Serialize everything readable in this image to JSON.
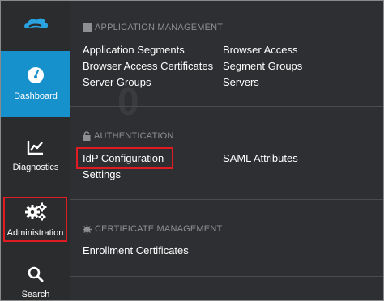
{
  "sidebar": {
    "items": [
      {
        "label": "Dashboard"
      },
      {
        "label": "Diagnostics"
      },
      {
        "label": "Administration"
      },
      {
        "label": "Search"
      }
    ]
  },
  "menu": {
    "sections": [
      {
        "title": "APPLICATION MANAGEMENT",
        "items": [
          "Application Segments",
          "Browser Access",
          "Browser Access Certificates",
          "Segment Groups",
          "Server Groups",
          "Servers"
        ]
      },
      {
        "title": "AUTHENTICATION",
        "items": [
          "IdP Configuration",
          "SAML Attributes",
          "Settings"
        ]
      },
      {
        "title": "CERTIFICATE MANAGEMENT",
        "items": [
          "Enrollment Certificates"
        ]
      }
    ]
  },
  "colors": {
    "accent": "#1791cc",
    "highlight": "#e11b22",
    "sidebar_bg": "#2b2c2e",
    "panel_bg": "#2e2f32"
  }
}
